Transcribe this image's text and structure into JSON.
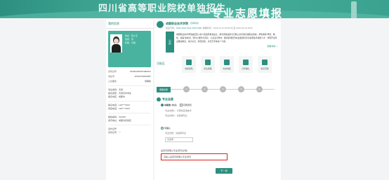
{
  "banner": {
    "line1": "四川省高等职业院校单独招生",
    "line2": "一专业志愿填报"
  },
  "profile": {
    "title": "我的信息",
    "name_row": "姓名：陈小玉",
    "gender_row": "性别：男",
    "ethnic_row": "民族：汉族",
    "fields": [
      {
        "label": "身份证号",
        "value": "513901200307080031"
      },
      {
        "label": "考生号",
        "value": "20510709000087"
      },
      {
        "label": "公共服务",
        "value": "待审核"
      }
    ],
    "group1": [
      "考生类别：普通",
      "报名类型：普通高中考生",
      "报名地区：成都市"
    ],
    "group2": [
      "联系电话：138****0667",
      "家庭电话：138****0667"
    ],
    "group3": [
      "邮政编码：610000",
      "通讯地址：成都市武侯区"
    ],
    "group4": [
      "身份证号",
      "身份证号：一"
    ]
  },
  "school": {
    "name": "成都职业技术学院",
    "tag": "查看院校",
    "meta_prefix": "招生代码：",
    "meta_code": "5101 0010 5101 0010 0001",
    "meta_time": "填报时间：2022-04-12 09:00:00 至 2022-04-18 18:00",
    "badge": "公办",
    "desc": "成都职业技术学院是经四川省人民政府批准设立、教育部备案的全日制公办普通高等职业院校，学院秉承“厚德、精技、尚美”的校训，坚持以服务为宗旨、以就业为导向，面向区域经济社会发展培养高素质技术技能人才。学院开设专业覆盖制造、电子信息、财经商贸、文化艺术等多个大类。",
    "more": "查看详情 >"
  },
  "quick": {
    "title": "功能区",
    "items": [
      "填报须知",
      "招生章程",
      "志愿填报",
      "打印确认",
      "常见问题"
    ]
  },
  "steps": {
    "current": "填报志愿",
    "nums": [
      "1",
      "2",
      "3",
      "4",
      "5",
      "6"
    ]
  },
  "form": {
    "section": "专业志愿",
    "first_option": "中职类",
    "first_option_note": "(单选)",
    "check_label": "同意调剂",
    "sub1": "专业志愿1：计算机应用技术",
    "sub2": "专业志愿2：请选择专业",
    "second_option": "待确认",
    "second_sub": "专业志愿：请选择专业",
    "select_placeholder": "请选择",
    "question": "是否同意服从专业调剂(必填)",
    "answer": "请输入是否同意服从专业调剂"
  },
  "actions": {
    "next": "下一步"
  }
}
